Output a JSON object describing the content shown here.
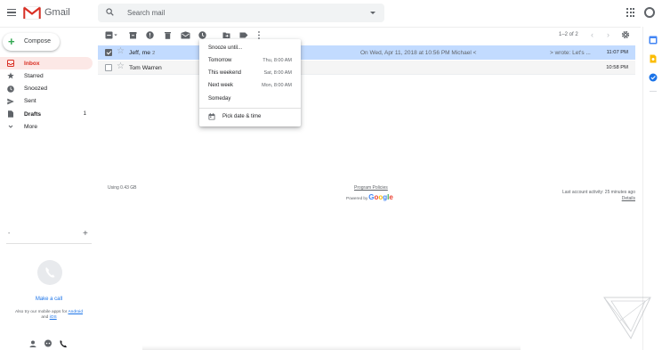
{
  "header": {
    "app_name": "Gmail",
    "search_placeholder": "Search mail",
    "icons": [
      "menu-icon",
      "gmail-logo",
      "search-icon",
      "search-options-icon",
      "apps-icon",
      "account-icon"
    ]
  },
  "compose": {
    "label": "Compose"
  },
  "sidebar": {
    "items": [
      {
        "label": "Inbox",
        "icon": "inbox-icon",
        "active": true,
        "count": ""
      },
      {
        "label": "Starred",
        "icon": "star-icon",
        "active": false,
        "count": ""
      },
      {
        "label": "Snoozed",
        "icon": "clock-icon",
        "active": false,
        "count": ""
      },
      {
        "label": "Sent",
        "icon": "send-icon",
        "active": false,
        "count": ""
      },
      {
        "label": "Drafts",
        "icon": "draft-icon",
        "active": false,
        "count": "1"
      },
      {
        "label": "More",
        "icon": "chevron-down-icon",
        "active": false,
        "count": ""
      }
    ],
    "hangouts_dash": "-",
    "hangouts_plus": "+",
    "make_call": "Make a call",
    "also_try_prefix": "Also try our mobile apps for",
    "android_link": "Android",
    "and_text": "and",
    "ios_link": "iOS"
  },
  "toolbar": {
    "pager": "1–2 of 2",
    "prev": "‹",
    "next": "›"
  },
  "emails": [
    {
      "sender": "Jeff, me",
      "count": "2",
      "snippet": "On Wed, Apr 11, 2018 at 10:56 PM Michael <",
      "snippet_tail": "> wrote: Let's ...",
      "time": "11:07 PM",
      "selected": true
    },
    {
      "sender": "Tom Warren",
      "count": "",
      "snippet": "",
      "snippet_tail": "",
      "time": "10:58 PM",
      "selected": false
    }
  ],
  "snooze_menu": {
    "title": "Snooze until...",
    "options": [
      {
        "label": "Tomorrow",
        "time": "Thu, 8:00 AM"
      },
      {
        "label": "This weekend",
        "time": "Sat, 8:00 AM"
      },
      {
        "label": "Next week",
        "time": "Mon, 8:00 AM"
      },
      {
        "label": "Someday",
        "time": ""
      }
    ],
    "pick_label": "Pick date & time"
  },
  "footer": {
    "storage": "Using 0.43 GB",
    "policies": "Program Policies",
    "powered_by": "Powered by",
    "google": "Google",
    "activity": "Last account activity: 25 minutes ago",
    "details": "Details"
  },
  "colors": {
    "accent_red": "#d93025",
    "selected_row": "#c2dbff",
    "link_blue": "#1a73e8"
  }
}
